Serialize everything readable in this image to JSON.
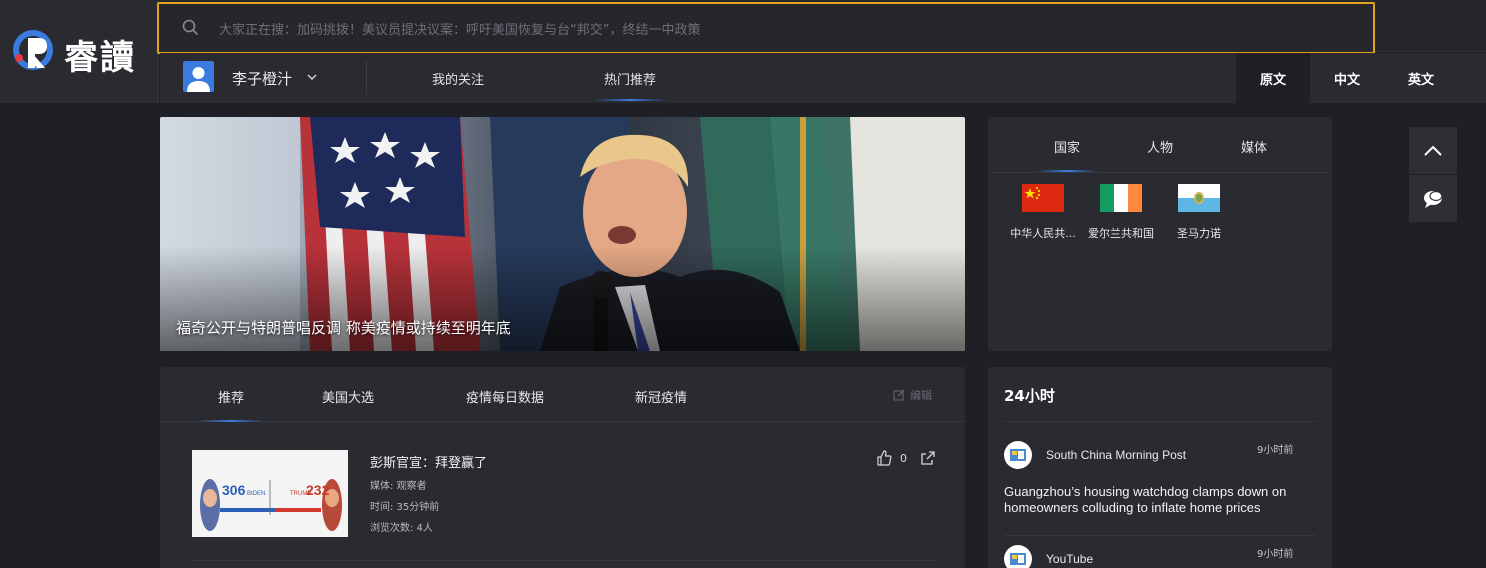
{
  "brand": {
    "name": "睿讀"
  },
  "search": {
    "placeholder": "大家正在搜：加码挑拨！美议员提决议案：呼吁美国恢复与台“邦交”，终结一中政策"
  },
  "user": {
    "name": "李子橙汁"
  },
  "nav": {
    "links": [
      {
        "label": "我的关注",
        "active": false
      },
      {
        "label": "热门推荐",
        "active": true
      }
    ],
    "languages": [
      {
        "label": "原文",
        "active": true
      },
      {
        "label": "中文",
        "active": false
      },
      {
        "label": "英文",
        "active": false
      }
    ]
  },
  "hero": {
    "caption": "福奇公开与特朗普唱反调 称美疫情或持续至明年底"
  },
  "entity_panel": {
    "tabs": [
      {
        "label": "国家",
        "active": true
      },
      {
        "label": "人物",
        "active": false
      },
      {
        "label": "媒体",
        "active": false
      }
    ],
    "countries": [
      {
        "name": "中华人民共...",
        "flag": "china"
      },
      {
        "name": "爱尔兰共和国",
        "flag": "ireland"
      },
      {
        "name": "圣马力诺",
        "flag": "san-marino"
      }
    ]
  },
  "feed": {
    "tabs": [
      {
        "label": "推荐",
        "active": true
      },
      {
        "label": "美国大选",
        "active": false
      },
      {
        "label": "疫情每日数据",
        "active": false
      },
      {
        "label": "新冠疫情",
        "active": false
      }
    ],
    "edit_label": "编辑",
    "articles": [
      {
        "title": "彭斯官宣：拜登赢了",
        "media": "媒体: 观察者",
        "time": "时间: 35分钟前",
        "views": "浏览次数: 4人",
        "likes": "0",
        "thumb": {
          "left_number": "306",
          "right_number": "232",
          "left_label": "BIDEN",
          "right_label": "TRUMP"
        }
      }
    ]
  },
  "news24": {
    "title": "24小时",
    "items": [
      {
        "source": "South China Morning Post",
        "time": "9小时前",
        "headline": "Guangzhou’s housing watchdog clamps down on homeowners colluding to inflate home prices"
      },
      {
        "source": "YouTube",
        "time": "9小时前",
        "headline": ""
      }
    ]
  },
  "colors": {
    "background": "#1f1f26",
    "panel": "#2a2a31",
    "accent_blue": "#3a7be0",
    "search_border": "#e0a418",
    "logo_red": "#e53945"
  },
  "icons": [
    "logo-icon",
    "search-icon",
    "avatar-icon",
    "chevron-down-icon",
    "chevron-up-icon",
    "chat-icon",
    "edit-icon",
    "thumbs-up-icon",
    "share-icon"
  ]
}
